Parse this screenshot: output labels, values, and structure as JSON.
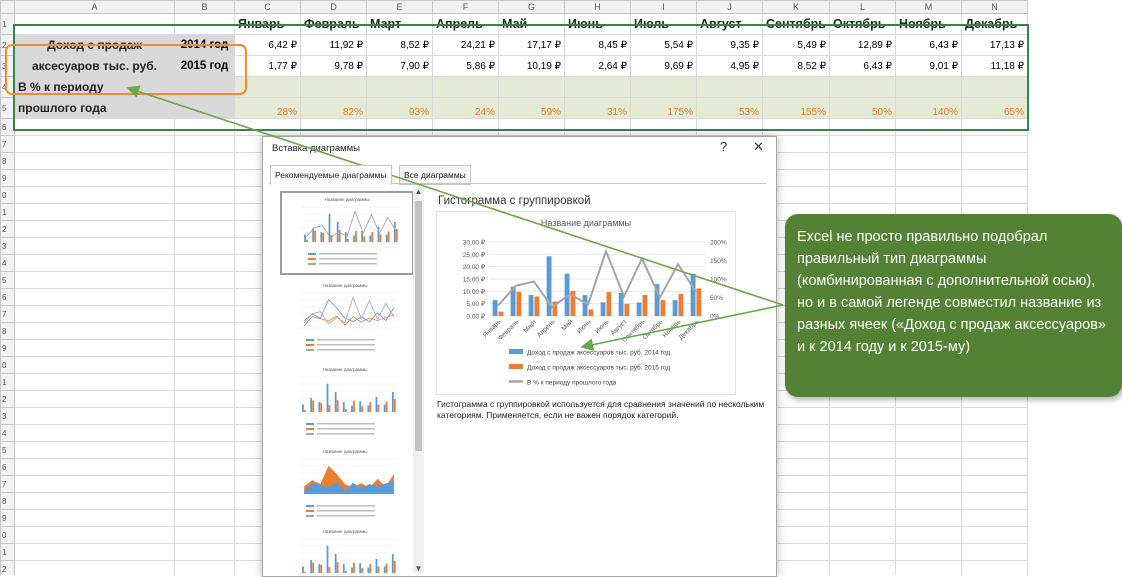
{
  "sheet": {
    "columns": [
      "A",
      "B",
      "C",
      "D",
      "E",
      "F",
      "G",
      "H",
      "I",
      "J",
      "K",
      "L",
      "M",
      "N"
    ],
    "row_numbers": [
      "1",
      "2",
      "3",
      "4",
      "5",
      "6",
      "7",
      "8",
      "9",
      "0",
      "1",
      "2",
      "3",
      "4",
      "5",
      "6",
      "7",
      "8",
      "9",
      "0",
      "1",
      "2",
      "3",
      "4",
      "5",
      "6",
      "7",
      "8",
      "9",
      "0",
      "1",
      "2"
    ],
    "months": [
      "Январь",
      "Февраль",
      "Март",
      "Апрель",
      "Май",
      "Июнь",
      "Июль",
      "Август",
      "Сентябрь",
      "Октябрь",
      "Ноябрь",
      "Декабрь"
    ],
    "label_line1": "Доход с продаж",
    "label_line2": "аксесуаров тыс. руб.",
    "year_2014": "2014 год",
    "year_2015": "2015 год",
    "values_2014": [
      "6,42 ₽",
      "11,92 ₽",
      "8,52 ₽",
      "24,21 ₽",
      "17,17 ₽",
      "8,45 ₽",
      "5,54 ₽",
      "9,35 ₽",
      "5,49 ₽",
      "12,89 ₽",
      "6,43 ₽",
      "17,13 ₽"
    ],
    "values_2015": [
      "1,77 ₽",
      "9,78 ₽",
      "7,90 ₽",
      "5,86 ₽",
      "10,19 ₽",
      "2,64 ₽",
      "9,69 ₽",
      "4,95 ₽",
      "8,52 ₽",
      "6,43 ₽",
      "9,01 ₽",
      "11,18 ₽"
    ],
    "pct_label_line1": "В % к периоду",
    "pct_label_line2": "прошлого года",
    "pct_values": [
      "28%",
      "82%",
      "93%",
      "24%",
      "59%",
      "31%",
      "175%",
      "53%",
      "155%",
      "50%",
      "140%",
      "65%"
    ]
  },
  "dialog": {
    "title": "Вставка диаграммы",
    "help": "?",
    "close": "✕",
    "tab_recommended": "Рекомендуемые диаграммы",
    "tab_all": "Все диаграммы",
    "preview_title": "Гистограмма с группировкой",
    "chart_title": "Название диаграммы",
    "description": "Гистограмма с группировкой используется для сравнения значений по нескольким категориям. Применяется, если не важен порядок категорий.",
    "legend_2014": "Доход с продаж аксессуаров тыс. руб. 2014 год",
    "legend_2015": "Доход с продаж аксессуаров тыс. руб. 2015 год",
    "legend_pct": "В % к периоду прошлого года"
  },
  "callout": {
    "text": "Excel не просто правильно подобрал правильный тип диаграммы (комбинированная с дополнительной осью), но и в самой легенде совместил название из разных ячеек («Доход с продаж аксессуаров» и к 2014 году и к 2015-му)"
  },
  "colors": {
    "blue": "#5b9bd5",
    "orange": "#ed7d31",
    "gray": "#a5a5a5",
    "callout_green": "#548235",
    "selection_green": "#3d7f4f",
    "selection_orange": "#ed8d2c"
  },
  "chart_data": {
    "type": "bar",
    "title": "Название диаграммы",
    "categories": [
      "Январь",
      "Февраль",
      "Март",
      "Апрель",
      "Май",
      "Июнь",
      "Июль",
      "Август",
      "Сентябрь",
      "Октябрь",
      "Ноябрь",
      "Декабрь"
    ],
    "series": [
      {
        "name": "Доход с продаж аксессуаров тыс. руб. 2014 год",
        "type": "bar",
        "axis": "primary",
        "values": [
          6.42,
          11.92,
          8.52,
          24.21,
          17.17,
          8.45,
          5.54,
          9.35,
          5.49,
          12.89,
          6.43,
          17.13
        ]
      },
      {
        "name": "Доход с продаж аксессуаров тыс. руб. 2015 год",
        "type": "bar",
        "axis": "primary",
        "values": [
          1.77,
          9.78,
          7.9,
          5.86,
          10.19,
          2.64,
          9.69,
          4.95,
          8.52,
          6.43,
          9.01,
          11.18
        ]
      },
      {
        "name": "В % к периоду прошлого года",
        "type": "line",
        "axis": "secondary",
        "values": [
          28,
          82,
          93,
          24,
          59,
          31,
          175,
          53,
          155,
          50,
          140,
          65
        ]
      }
    ],
    "ylim": [
      0,
      30
    ],
    "y2lim": [
      0,
      200
    ],
    "y_ticks": [
      "0,00 ₽",
      "5,00 ₽",
      "10,00 ₽",
      "15,00 ₽",
      "20,00 ₽",
      "25,00 ₽",
      "30,00 ₽"
    ],
    "y2_ticks": [
      "0%",
      "50%",
      "100%",
      "150%",
      "200%"
    ],
    "legend": "bottom"
  }
}
